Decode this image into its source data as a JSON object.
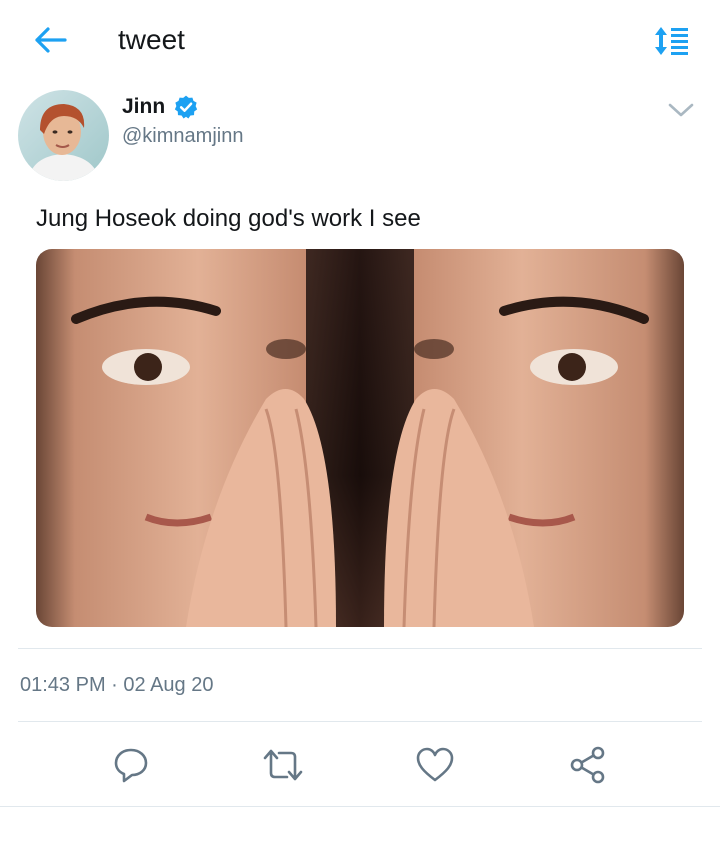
{
  "header": {
    "title": "tweet"
  },
  "tweet": {
    "author": {
      "name": "Jinn",
      "handle": "@kimnamjinn",
      "verified": true
    },
    "text": "Jung Hoseok doing god's work I see",
    "timestamp": "01:43 PM · 02 Aug 20",
    "media": {
      "type": "image",
      "description_icon": "mirrored-face-photo"
    }
  },
  "actions": [
    {
      "name": "reply",
      "icon": "reply-icon"
    },
    {
      "name": "retweet",
      "icon": "retweet-icon"
    },
    {
      "name": "like",
      "icon": "heart-icon"
    },
    {
      "name": "share",
      "icon": "share-icon"
    }
  ],
  "colors": {
    "accent": "#1da1f2",
    "icon_gray": "#657786",
    "divider": "#e1e8ed"
  }
}
